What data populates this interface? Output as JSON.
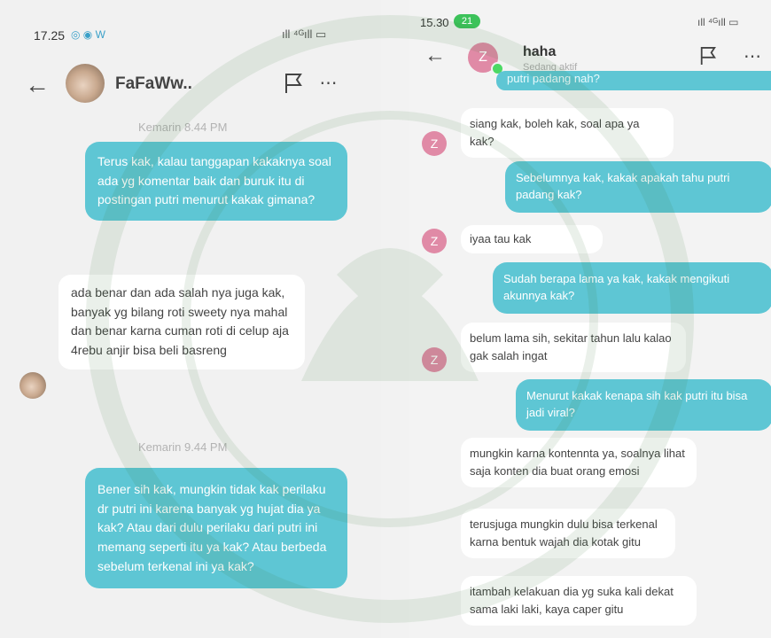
{
  "left": {
    "status": {
      "time": "17.25",
      "icons": "◎ ◉ W",
      "right_icons": "ıll ⁴ᴳıll ▭"
    },
    "header": {
      "name": "FaFaWw.."
    },
    "messages": [
      {
        "type": "timestamp",
        "text": "Kemarin 8.44 PM"
      },
      {
        "type": "outgoing",
        "text": "Terus kak, kalau tanggapan kakaknya soal ada yg komentar baik dan buruk itu di postingan putri menurut kakak gimana?"
      },
      {
        "type": "incoming",
        "text": "ada benar dan ada salah nya juga kak, banyak yg bilang roti sweety nya mahal dan benar karna cuman roti di celup aja 4rebu anjir bisa beli basreng"
      },
      {
        "type": "timestamp",
        "text": "Kemarin 9.44 PM"
      },
      {
        "type": "outgoing",
        "text": "Bener sih kak, mungkin tidak kak perilaku dr putri ini karena banyak yg hujat dia ya kak? Atau dari dulu perilaku dari putri ini memang seperti itu ya kak? Atau berbeda sebelum terkenal ini ya kak?"
      }
    ]
  },
  "right": {
    "status": {
      "time": "15.30",
      "battery_pill": "21",
      "right_icons": "ıll ⁴ᴳıll ▭"
    },
    "header": {
      "name": "haha",
      "status": "Sedang aktif",
      "avatar_letter": "Z"
    },
    "messages": [
      {
        "type": "outgoing",
        "text": "putri padang nah?"
      },
      {
        "type": "incoming",
        "text": "siang kak,  boleh kak,  soal apa ya kak?"
      },
      {
        "type": "outgoing",
        "text": "Sebelumnya kak, kakak apakah tahu putri padang kak?"
      },
      {
        "type": "incoming",
        "text": "iyaa tau kak"
      },
      {
        "type": "outgoing",
        "text": "Sudah berapa lama ya kak, kakak mengikuti akunnya kak?"
      },
      {
        "type": "incoming",
        "text": "belum lama sih, sekitar tahun lalu kalao gak salah ingat"
      },
      {
        "type": "outgoing",
        "text": "Menurut kakak kenapa sih kak putri itu bisa jadi viral?"
      },
      {
        "type": "incoming",
        "text": "mungkin karna kontennta  ya, soalnya lihat saja konten dia buat orang emosi"
      },
      {
        "type": "incoming",
        "text": "terusjuga mungkin dulu bisa terkenal karna bentuk wajah dia kotak gitu"
      },
      {
        "type": "incoming",
        "text": "itambah kelakuan dia yg suka kali dekat sama laki laki,  kaya caper gitu"
      }
    ]
  }
}
